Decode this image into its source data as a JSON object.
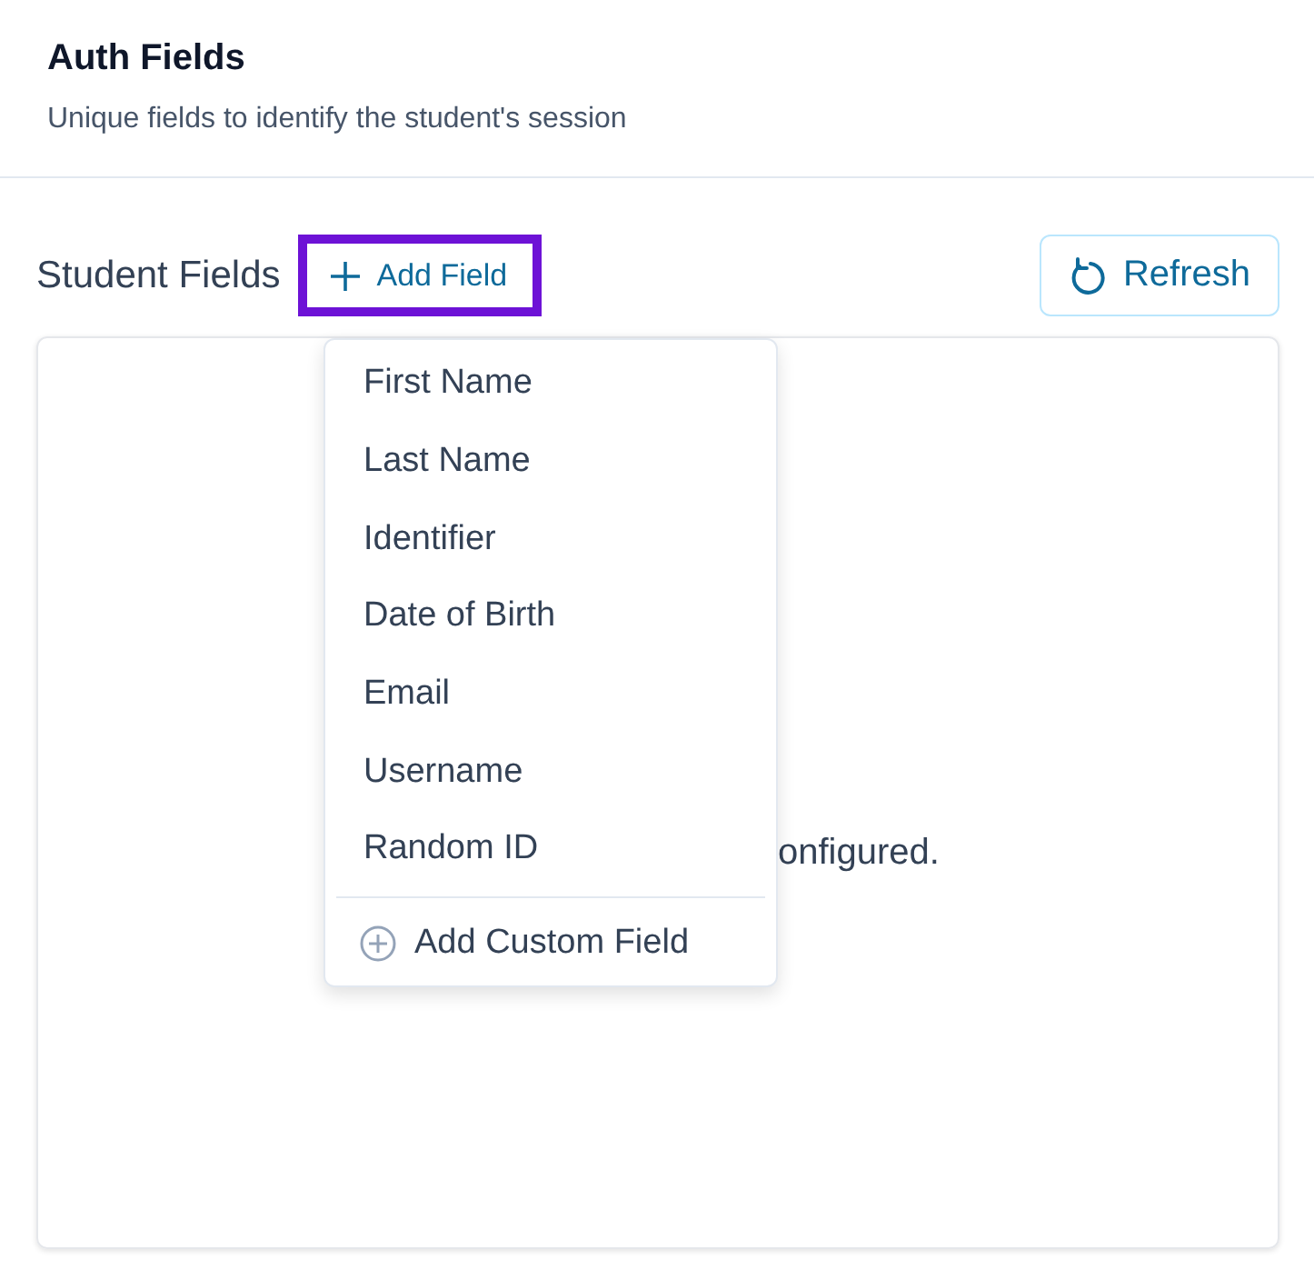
{
  "header": {
    "title": "Auth Fields",
    "subtitle": "Unique fields to identify the student's session"
  },
  "section": {
    "title": "Student Fields",
    "add_button": "Add Field",
    "add_button_highlighted": true,
    "refresh_button": "Refresh"
  },
  "empty_message": "onfigured.",
  "menu": {
    "items": [
      {
        "label": "First Name"
      },
      {
        "label": "Last Name"
      },
      {
        "label": "Identifier"
      },
      {
        "label": "Date of Birth"
      },
      {
        "label": "Email"
      },
      {
        "label": "Username"
      },
      {
        "label": "Random ID"
      }
    ],
    "custom": "Add Custom Field"
  }
}
